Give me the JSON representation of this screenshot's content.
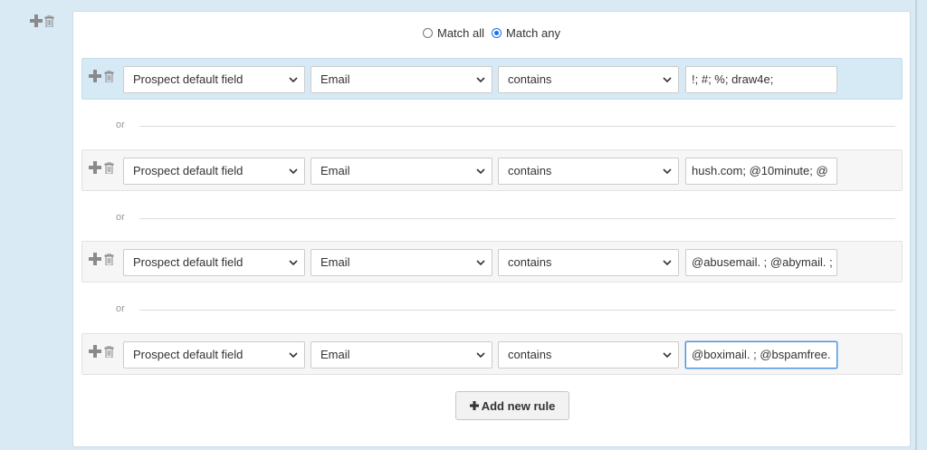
{
  "match": {
    "all_label": "Match all",
    "any_label": "Match any",
    "selected": "any"
  },
  "or_label": "or",
  "rules": [
    {
      "field_type": "Prospect default field",
      "field": "Email",
      "operator": "contains",
      "value": "!; #; %; draw4e;"
    },
    {
      "field_type": "Prospect default field",
      "field": "Email",
      "operator": "contains",
      "value": "hush.com; @10minute; @"
    },
    {
      "field_type": "Prospect default field",
      "field": "Email",
      "operator": "contains",
      "value": "@abusemail. ; @abymail. ;"
    },
    {
      "field_type": "Prospect default field",
      "field": "Email",
      "operator": "contains",
      "value": "@boximail. ; @bspamfree."
    }
  ],
  "add_rule_label": "Add new rule",
  "icons": {
    "add": "plus-icon",
    "delete": "trash-icon",
    "dropdown": "chevron-down-icon"
  },
  "colors": {
    "active_rule_bg": "#d6eaf5",
    "radio_accent": "#1a73e8"
  }
}
